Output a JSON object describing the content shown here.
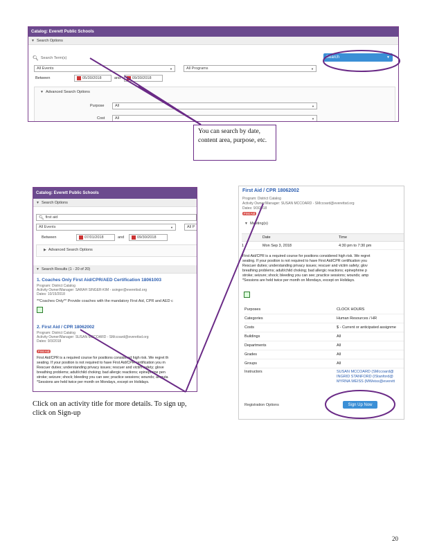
{
  "colors": {
    "accent": "#6b4a8e",
    "annotation": "#6a2a86",
    "button": "#3b8fd6",
    "badge": "#d9534f"
  },
  "top": {
    "catalog_title": "Catalog: Everett Public Schools",
    "search_options": "Search Options",
    "search_term": "Search Term(s)",
    "search_button": "Search",
    "all_events": "All Events",
    "all_programs": "All Programs",
    "between": "Between",
    "date_from": "05/30/2018",
    "and": "and",
    "date_to": "09/30/2018",
    "advanced": "Advanced Search Options",
    "purpose_label": "Purpose",
    "purpose_value": "All",
    "cost_label": "Cost",
    "cost_value": "All"
  },
  "note_top": "You can search by date, content area, purpose, etc.",
  "left": {
    "catalog_title": "Catalog: Everett Public Schools",
    "search_options": "Search Options",
    "search_value": "first aid",
    "all_events": "All Events",
    "all_programs": "All P",
    "between": "Between",
    "date_from": "07/01/2018",
    "and": "and",
    "date_to": "09/30/2018",
    "advanced": "Advanced Search Options",
    "results": "Search Results (1 - 20 of 20)",
    "r1_title": "1. Coaches Only First Aid/CPR/AED Certification 18061003",
    "r1_program": "Program: District Catalog",
    "r1_owner": "Activity Owner/Manager: SARAH SINGER-KIM - ssinger@everettsd.org",
    "r1_dates": "Dates: 10/15/2018",
    "r1_desc": "**Coaches Only** Provide coaches with the mandatory First Aid, CPR and AED c",
    "r2_title": "2. First Aid / CPR 18062002",
    "r2_program": "Program: District Catalog",
    "r2_owner": "Activity Owner/Manager: SUSAN MCCOARD - SMccoard@everettsd.org",
    "r2_dates": "Dates: 9/3/2018",
    "r2_badge": "First Aid",
    "r2_desc": [
      "First Aid/CPR is a required course for positions considered high risk. We regret th",
      "seating. If your position is not required to have First Aid/CPR certification you m",
      "Rescuer duties; understanding privacy issues; rescuer and victim safety; glove",
      "breathing problems; adult/child choking; bad allergic reactions; epinephrine pen",
      "stroke; seizure; shock; bleeding you can see; practice sessions; wounds; amputa",
      "*Sessions are held twice per month on Mondays, except on Holidays."
    ]
  },
  "note_bottom": "Click on an activity title for more details. To sign up, click on Sign-up",
  "right": {
    "title": "First Aid / CPR 18062002",
    "program": "Program: District Catalog",
    "owner": "Activity Owner/Manager: SUSAN MCCOARD - SMccoard@everettsd.org",
    "dates": "Dates: 9/3/2018",
    "badge": "First Aid",
    "meetings": "Meeting(s)",
    "col_date": "Date",
    "col_time": "Time",
    "m_num": "1",
    "m_date": "Mon Sep 3, 2018",
    "m_time": "4:30 pm to 7:30 pm",
    "desc": [
      "First Aid/CPR is a required course for positions considered high risk. We regret",
      "seating. If your position is not required to have First Aid/CPR certification you",
      "Rescuer duties; understanding privacy issues; rescuer and victim safety; glov",
      "breathing problems; adult/child choking; bad allergic reactions; epinephrine p",
      "stroke; seizure; shock; bleeding you can see; practice sessions; wounds; amp",
      "*Sessions are held twice per month on Mondays, except on Holidays."
    ],
    "details": [
      {
        "label": "Purposes",
        "value": "CLOCK HOURS"
      },
      {
        "label": "Categories",
        "value": "Human Resources / HR"
      },
      {
        "label": "Costs",
        "value": "$ - Current or anticipated assignme"
      },
      {
        "label": "Buildings",
        "value": "All"
      },
      {
        "label": "Departments",
        "value": "All"
      },
      {
        "label": "Grades",
        "value": "All"
      },
      {
        "label": "Groups",
        "value": "All"
      }
    ],
    "instructors_label": "Instructors",
    "instructors": [
      "SUSAN MCCOARD (SMccoard@",
      "INGRID STANFORD (IStanford@",
      "MYRNA WEISS (MWeiss@everett"
    ],
    "reg_label": "Registration Options",
    "signup": "Sign Up Now"
  },
  "page_number": "20"
}
